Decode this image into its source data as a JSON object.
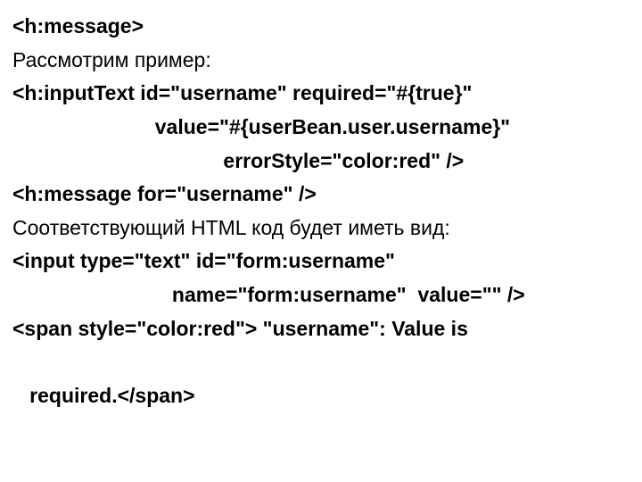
{
  "lines": [
    {
      "text": "<h:message>",
      "bold": true
    },
    {
      "text": "Рассмотрим пример:",
      "bold": false
    },
    {
      "text": "<h:inputText id=\"username\" required=\"#{true}\"",
      "bold": true
    },
    {
      "text": "                         value=\"#{userBean.user.username}\"",
      "bold": true
    },
    {
      "text": "                                     errorStyle=\"color:red\" />",
      "bold": true
    },
    {
      "text": "<h:message for=\"username\" />",
      "bold": true
    },
    {
      "text": "Соответствующий HTML код будет иметь вид:",
      "bold": false
    },
    {
      "text": "<input type=\"text\" id=\"form:username\"",
      "bold": true
    },
    {
      "text": "                            name=\"form:username\"  value=\"\" />",
      "bold": true
    },
    {
      "text": "<span style=\"color:red\"> \"username\": Value is",
      "bold": true
    },
    {
      "text": " ",
      "bold": true
    },
    {
      "text": "   required.</span>",
      "bold": true
    }
  ]
}
